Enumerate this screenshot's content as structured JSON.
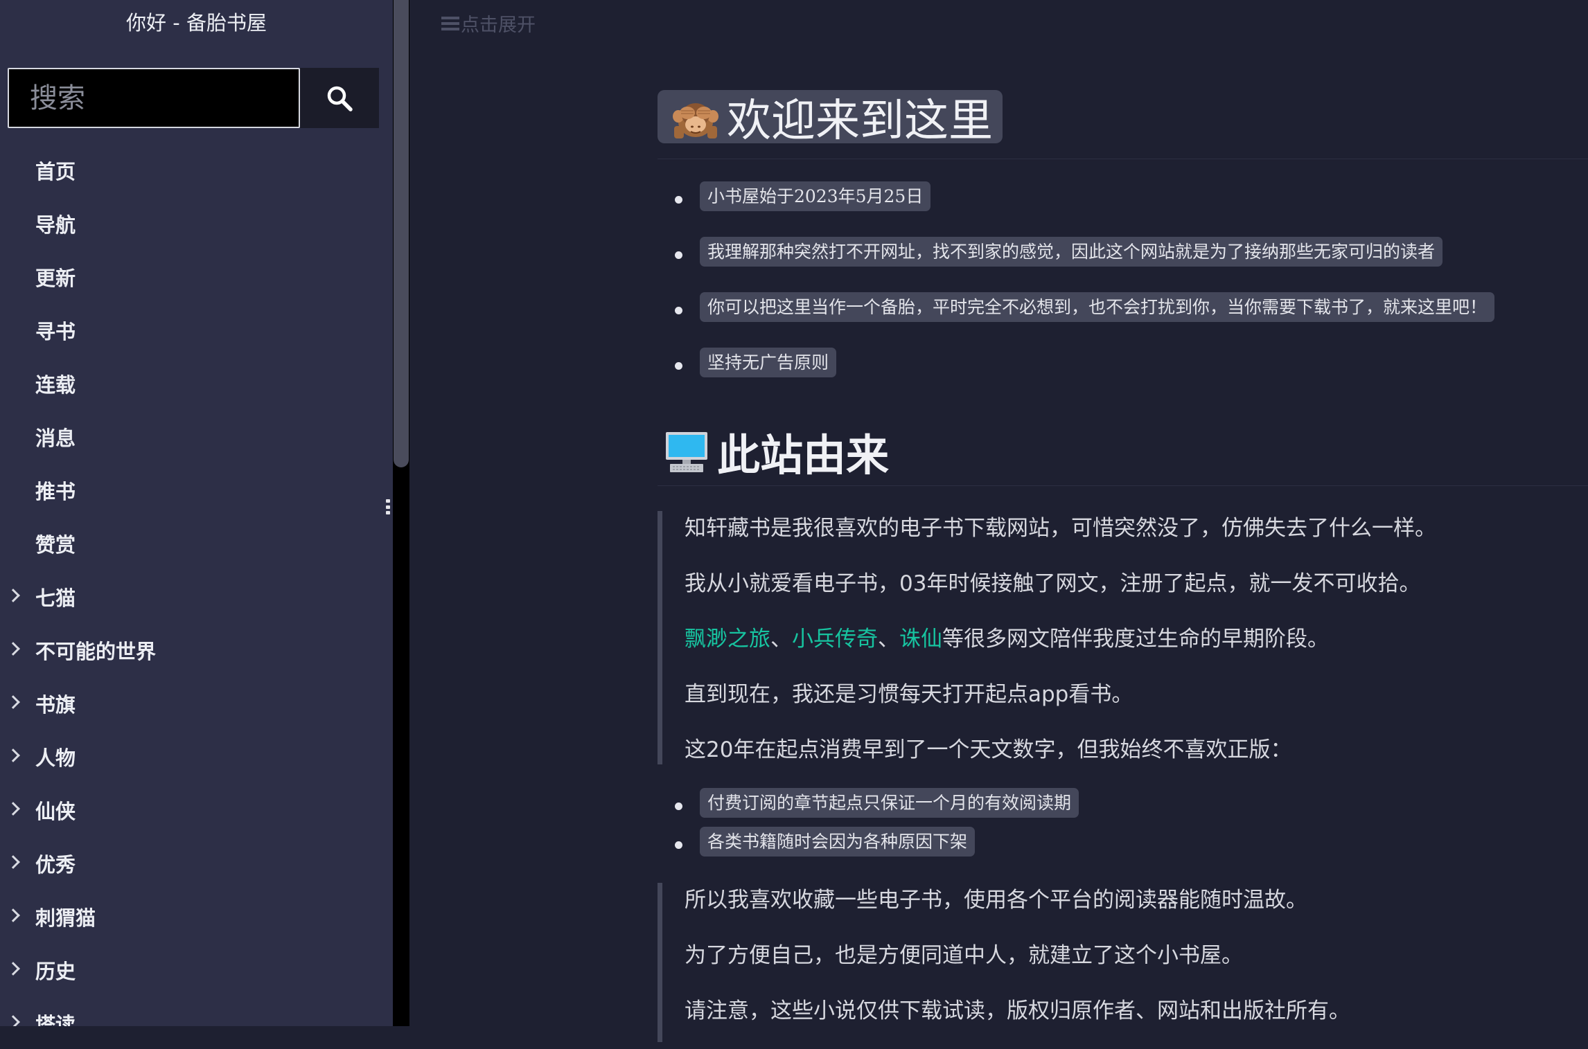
{
  "sidebar": {
    "title": "你好 - 备胎书屋",
    "search": {
      "placeholder": "搜索",
      "icon": "search-icon"
    },
    "items": [
      {
        "label": "首页",
        "expandable": false
      },
      {
        "label": "导航",
        "expandable": false
      },
      {
        "label": "更新",
        "expandable": false
      },
      {
        "label": "寻书",
        "expandable": false
      },
      {
        "label": "连载",
        "expandable": false
      },
      {
        "label": "消息",
        "expandable": false
      },
      {
        "label": "推书",
        "expandable": false
      },
      {
        "label": "赞赏",
        "expandable": false
      },
      {
        "label": "七猫",
        "expandable": true
      },
      {
        "label": "不可能的世界",
        "expandable": true
      },
      {
        "label": "书旗",
        "expandable": true
      },
      {
        "label": "人物",
        "expandable": true
      },
      {
        "label": "仙侠",
        "expandable": true
      },
      {
        "label": "优秀",
        "expandable": true
      },
      {
        "label": "刺猬猫",
        "expandable": true
      },
      {
        "label": "历史",
        "expandable": true
      },
      {
        "label": "塔读",
        "expandable": true
      }
    ]
  },
  "toggle": {
    "label": "点击展开",
    "icon": "menu-icon"
  },
  "welcome": {
    "icon": "see-no-evil-monkey-icon",
    "title": "欢迎来到这里",
    "bullets": [
      "小书屋始于2023年5月25日",
      "我理解那种突然打不开网址，找不到家的感觉，因此这个网站就是为了接纳那些无家可归的读者",
      "你可以把这里当作一个备胎，平时完全不必想到，也不会打扰到你，当你需要下载书了，就来这里吧！",
      "坚持无广告原则"
    ]
  },
  "origin": {
    "icon": "desktop-computer-icon",
    "title": "此站由来",
    "quote1": {
      "p1": "知轩藏书是我很喜欢的电子书下载网站，可惜突然没了，仿佛失去了什么一样。",
      "p2": "我从小就爱看电子书，03年时候接触了网文，注册了起点，就一发不可收拾。",
      "links": [
        "飘渺之旅",
        "小兵传奇",
        "诛仙"
      ],
      "sep": "、",
      "p3_tail": "等很多网文陪伴我度过生命的早期阶段。",
      "p4": "直到现在，我还是习惯每天打开起点app看书。",
      "p5": "这20年在起点消费早到了一个天文数字，但我始终不喜欢正版："
    },
    "bullets": [
      "付费订阅的章节起点只保证一个月的有效阅读期",
      "各类书籍随时会因为各种原因下架"
    ],
    "quote2": {
      "p1": "所以我喜欢收藏一些电子书，使用各个平台的阅读器能随时温故。",
      "p2": "为了方便自己，也是方便同道中人，就建立了这个小书屋。",
      "p3": "请注意，这些小说仅供下载试读，版权归原作者、网站和出版社所有。"
    }
  },
  "colors": {
    "sidebar_bg": "#2d2f47",
    "main_bg": "#1e2031",
    "chip_bg": "#44475a",
    "link": "#17c4a0"
  }
}
